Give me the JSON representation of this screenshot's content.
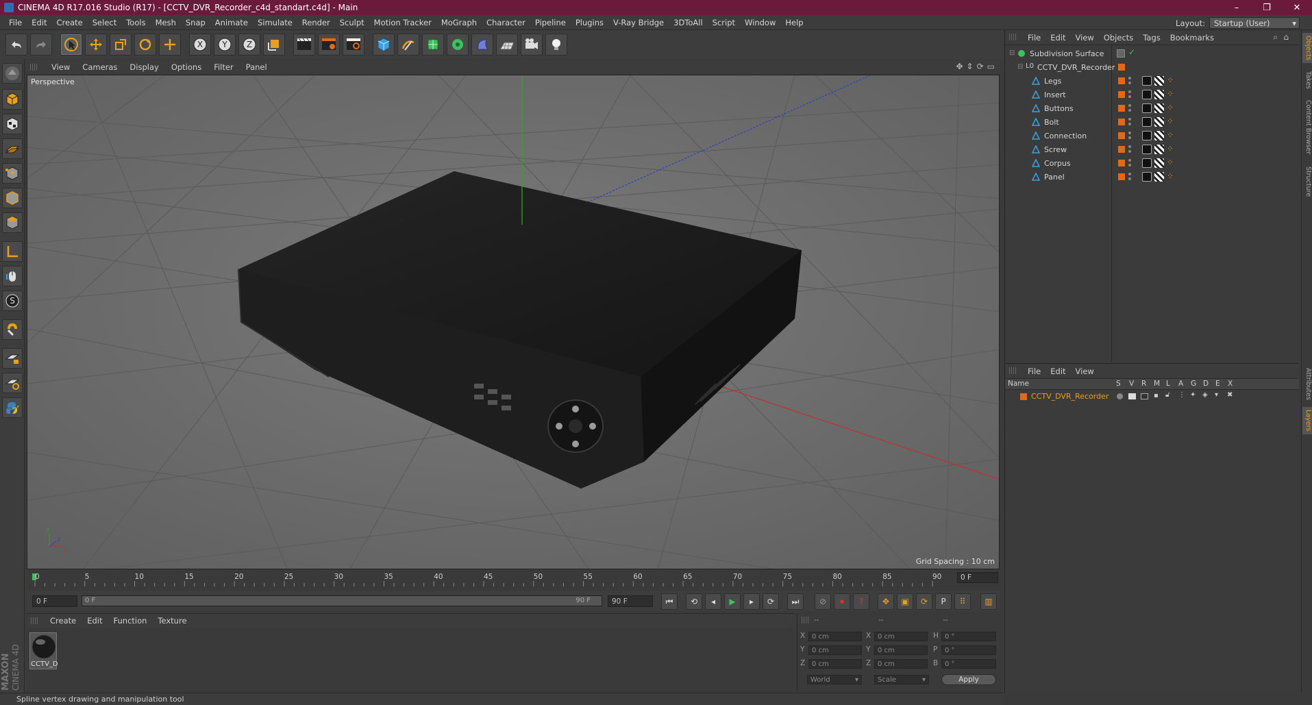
{
  "window": {
    "title": "CINEMA 4D R17.016 Studio (R17) - [CCTV_DVR_Recorder_c4d_standart.c4d] - Main",
    "controls": [
      "–",
      "❐",
      "✕"
    ]
  },
  "menubar": {
    "items": [
      "File",
      "Edit",
      "Create",
      "Select",
      "Tools",
      "Mesh",
      "Snap",
      "Animate",
      "Simulate",
      "Render",
      "Sculpt",
      "Motion Tracker",
      "MoGraph",
      "Character",
      "Pipeline",
      "Plugins",
      "V-Ray Bridge",
      "3DToAll",
      "Script",
      "Window",
      "Help"
    ],
    "layout_label": "Layout:",
    "layout_value": "Startup (User)"
  },
  "viewport": {
    "menu": [
      "View",
      "Cameras",
      "Display",
      "Options",
      "Filter",
      "Panel"
    ],
    "label": "Perspective",
    "grid_spacing": "Grid Spacing : 10 cm"
  },
  "timeline": {
    "ticks": [
      "0",
      "5",
      "10",
      "15",
      "20",
      "25",
      "30",
      "35",
      "40",
      "45",
      "50",
      "55",
      "60",
      "65",
      "70",
      "75",
      "80",
      "85",
      "90"
    ],
    "current_frame": "0 F"
  },
  "transport": {
    "start_field": "0 F",
    "slider_start": "0 F",
    "slider_end": "90 F",
    "end_field": "90 F"
  },
  "material_panel": {
    "menu": [
      "Create",
      "Edit",
      "Function",
      "Texture"
    ],
    "material_name": "CCTV_D"
  },
  "coord_panel": {
    "headers": [
      "--",
      "--",
      "--"
    ],
    "rows": [
      {
        "a_label": "X",
        "a_val": "0 cm",
        "b_label": "X",
        "b_val": "0 cm",
        "c_label": "H",
        "c_val": "0 °"
      },
      {
        "a_label": "Y",
        "a_val": "0 cm",
        "b_label": "Y",
        "b_val": "0 cm",
        "c_label": "P",
        "c_val": "0 °"
      },
      {
        "a_label": "Z",
        "a_val": "0 cm",
        "b_label": "Z",
        "b_val": "0 cm",
        "c_label": "B",
        "c_val": "0 °"
      }
    ],
    "world": "World",
    "scale": "Scale",
    "apply": "Apply"
  },
  "status": {
    "text": "Spline vertex drawing and manipulation tool"
  },
  "object_manager": {
    "menu": [
      "File",
      "Edit",
      "View",
      "Objects",
      "Tags",
      "Bookmarks"
    ],
    "objects": [
      {
        "name": "Subdivision Surface"
      },
      {
        "name": "CCTV_DVR_Recorder"
      },
      {
        "name": "Legs"
      },
      {
        "name": "Insert"
      },
      {
        "name": "Buttons"
      },
      {
        "name": "Bolt"
      },
      {
        "name": "Connection"
      },
      {
        "name": "Screw"
      },
      {
        "name": "Corpus"
      },
      {
        "name": "Panel"
      }
    ]
  },
  "layer_manager": {
    "menu": [
      "File",
      "Edit",
      "View"
    ],
    "columns": [
      "Name",
      "S",
      "V",
      "R",
      "M",
      "L",
      "A",
      "G",
      "D",
      "E",
      "X"
    ],
    "layers": [
      {
        "name": "CCTV_DVR_Recorder",
        "color": "#e06a1a"
      }
    ]
  },
  "side_tabs": [
    "Objects",
    "Takes",
    "Content Browser",
    "Structure",
    "Attributes",
    "Layers"
  ],
  "branding": {
    "maxon": "MAXON",
    "c4d": "CINEMA 4D"
  },
  "colors": {
    "accent": "#e06a1a",
    "titlebar": "#6c1a3b",
    "axis_x": "#c03030",
    "axis_y": "#30a030",
    "axis_z": "#3040c0"
  }
}
